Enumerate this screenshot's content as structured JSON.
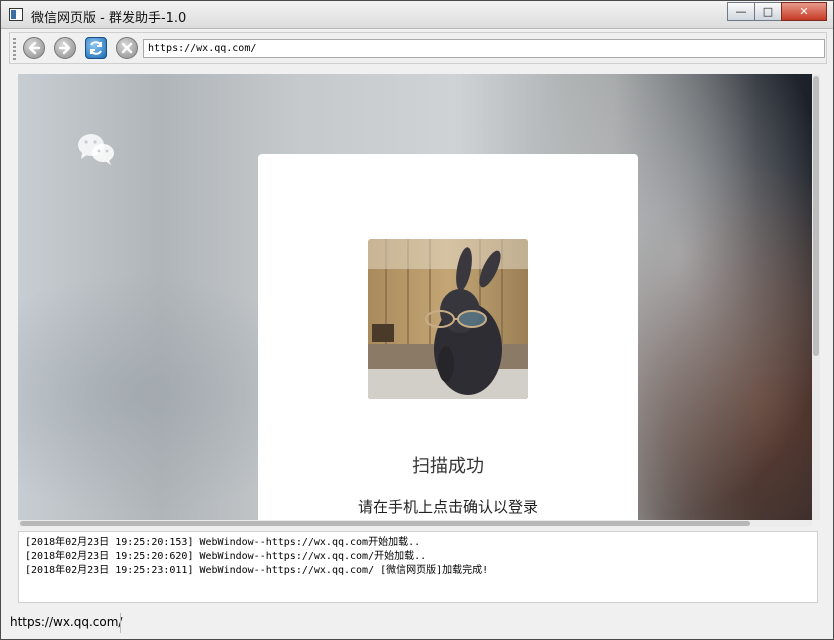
{
  "window": {
    "title": "微信网页版 - 群发助手-1.0",
    "controls": {
      "minimize": "—",
      "maximize": "□",
      "close": "✕"
    }
  },
  "toolbar": {
    "back_icon": "back-arrow-icon",
    "forward_icon": "forward-arrow-icon",
    "refresh_icon": "refresh-icon",
    "stop_icon": "stop-icon",
    "url": "https://wx.qq.com/"
  },
  "webpage": {
    "logo_icon": "wechat-logo-icon",
    "avatar_image": "rabbit-with-sunglasses-photo",
    "scan_status": "扫描成功",
    "scan_tip": "请在手机上点击确认以登录"
  },
  "log": {
    "lines": [
      "[2018年02月23日  19:25:20:153] WebWindow--https://wx.qq.com开始加载..",
      "[2018年02月23日  19:25:20:620] WebWindow--https://wx.qq.com/开始加载..",
      "[2018年02月23日  19:25:23:011] WebWindow--https://wx.qq.com/ [微信网页版]加载完成!"
    ]
  },
  "statusbar": {
    "text": "https://wx.qq.com/"
  }
}
